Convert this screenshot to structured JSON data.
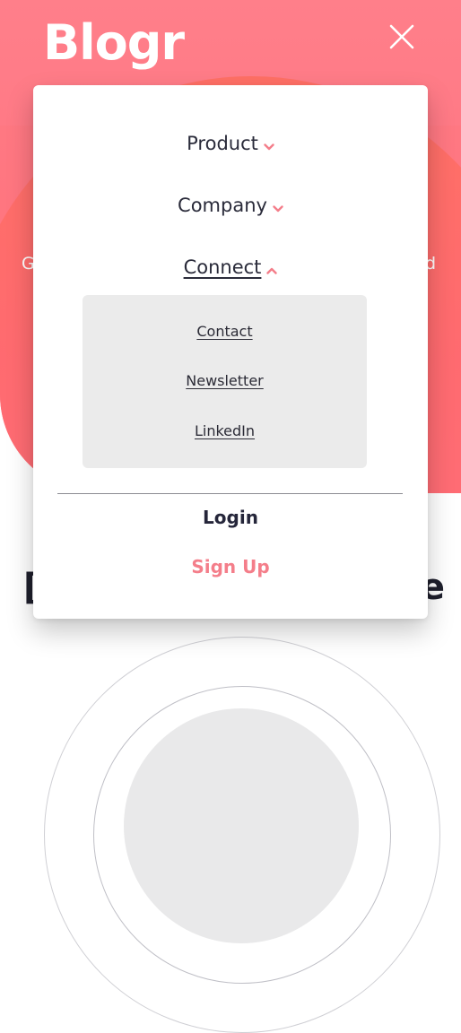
{
  "app": {
    "logo": "Blogr",
    "hero_peek_left": "G",
    "hero_peek_right": "d",
    "background_heading_left": "[",
    "background_heading_right": "e"
  },
  "menu": {
    "items": [
      {
        "label": "Product",
        "expanded": false,
        "icon": "chevron-down-icon"
      },
      {
        "label": "Company",
        "expanded": false,
        "icon": "chevron-down-icon"
      },
      {
        "label": "Connect",
        "expanded": true,
        "icon": "chevron-up-icon"
      }
    ],
    "connect_submenu": [
      "Contact",
      "Newsletter",
      "LinkedIn"
    ],
    "login_label": "Login",
    "signup_label": "Sign Up"
  },
  "colors": {
    "accent": "#f47e8a",
    "hero_top": "#ff7f8a",
    "hero_shape": "#ff6f63",
    "text_dark": "#2a2b3a",
    "submenu_bg": "#ebebeb"
  }
}
